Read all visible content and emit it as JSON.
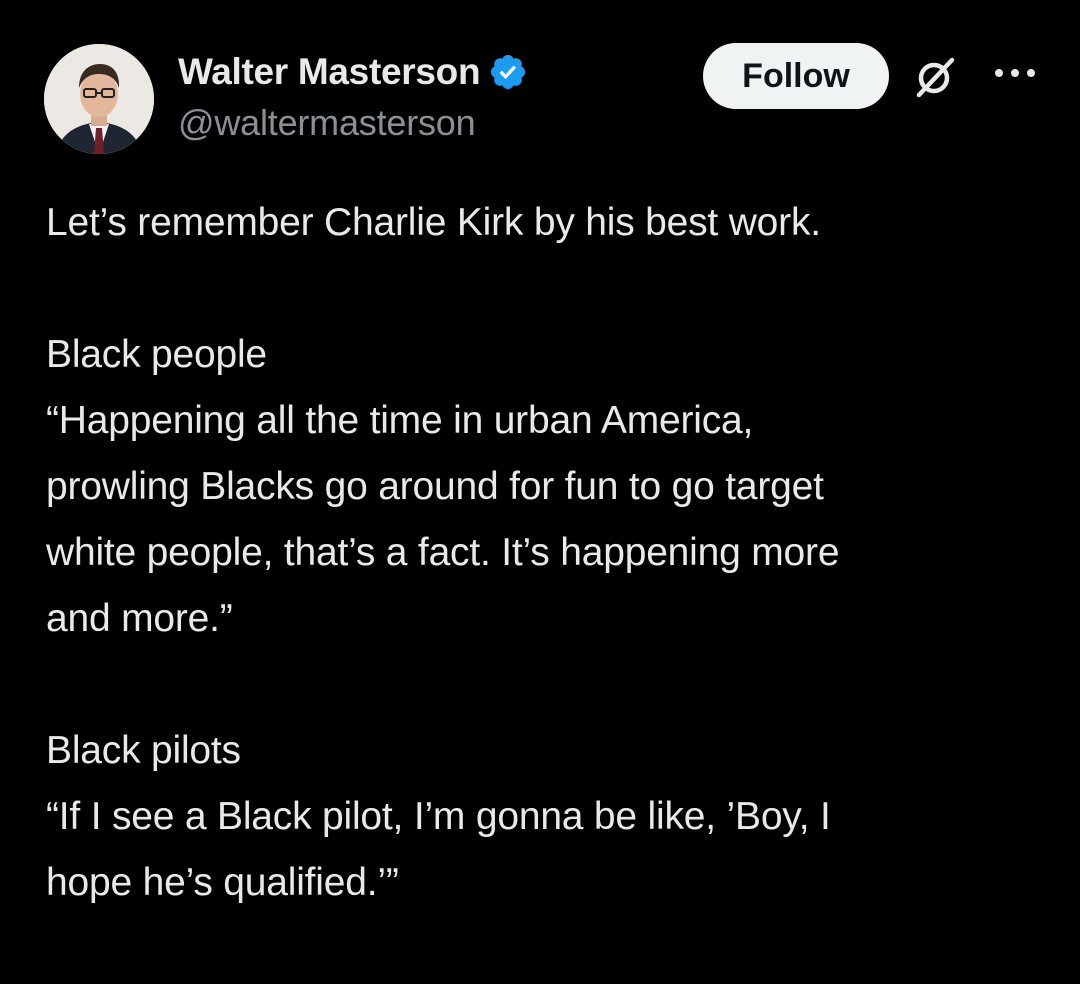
{
  "author": {
    "display_name": "Walter Masterson",
    "handle": "@waltermasterson",
    "verified_icon": "verified-badge-icon",
    "avatar_icon": "avatar-photo"
  },
  "actions": {
    "follow_label": "Follow",
    "grok_icon": "grok-icon",
    "more_icon": "more-options-icon"
  },
  "colors": {
    "background": "#000000",
    "text": "#e7e9ea",
    "secondary_text": "#8b9096",
    "verified_blue": "#1d9bf0",
    "follow_bg": "#eff3f4"
  },
  "post": {
    "intro": "Let’s remember Charlie Kirk by his best work.",
    "section1": {
      "heading": "Black people",
      "quote_lines": [
        "“Happening all the time in urban America,",
        "prowling Blacks go around for fun to go target",
        "white people, that’s a fact. It’s happening more",
        "and more.”"
      ]
    },
    "section2": {
      "heading": "Black pilots",
      "quote_lines": [
        "“If I see a Black pilot, I’m gonna be like, ’Boy, I",
        "hope he’s qualified.’”"
      ]
    }
  }
}
